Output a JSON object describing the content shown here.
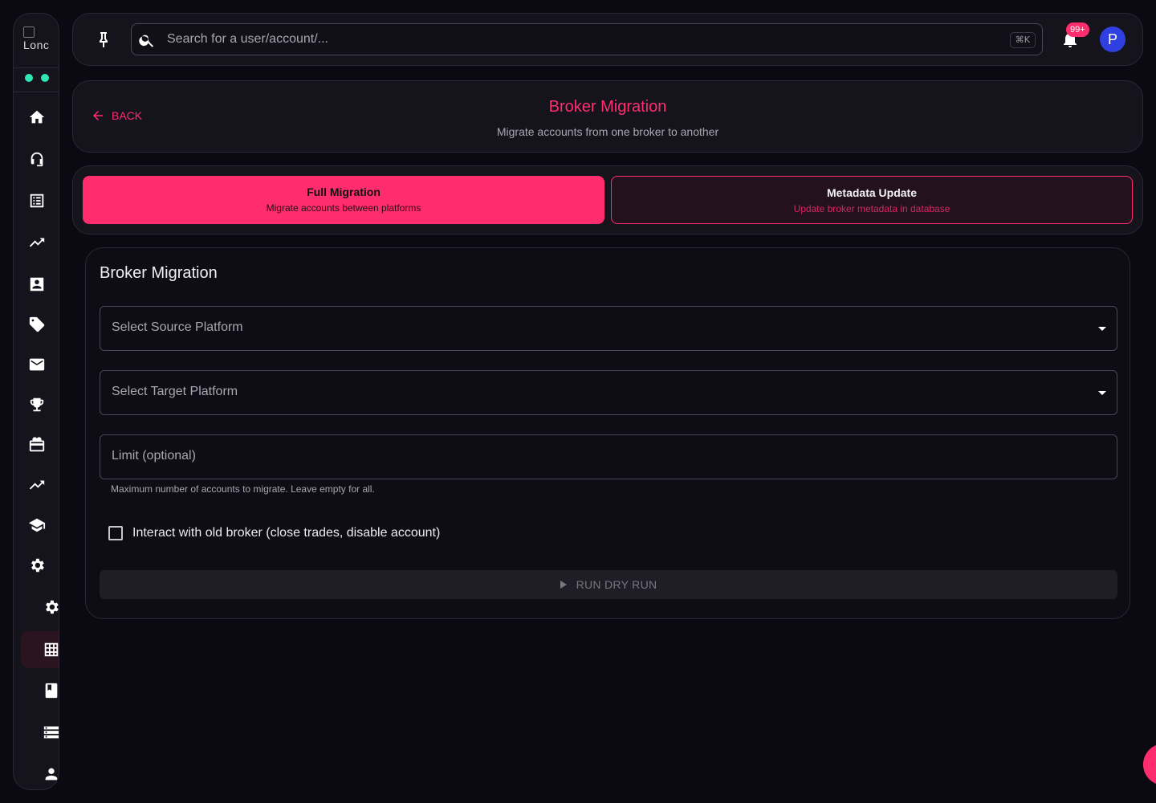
{
  "sidebar": {
    "logo_alt": "Logo",
    "logo_text": "Lonc",
    "items": [
      {
        "name": "home-icon"
      },
      {
        "name": "support-icon"
      },
      {
        "name": "list-icon"
      },
      {
        "name": "trending-icon"
      },
      {
        "name": "contact-icon"
      },
      {
        "name": "tag-icon"
      },
      {
        "name": "mail-icon"
      },
      {
        "name": "trophy-icon"
      },
      {
        "name": "gift-icon"
      },
      {
        "name": "trending-icon"
      },
      {
        "name": "school-icon"
      },
      {
        "name": "gear-icon"
      },
      {
        "name": "gear-icon"
      },
      {
        "name": "grid-icon"
      },
      {
        "name": "book-icon"
      },
      {
        "name": "storage-icon"
      },
      {
        "name": "person-icon"
      }
    ],
    "status_color": "#2ee6b6"
  },
  "topbar": {
    "search_placeholder": "Search for a user/account/...",
    "shortcut": "⌘K",
    "notifications_badge": "99+",
    "avatar_letter": "P"
  },
  "header": {
    "back_label": "BACK",
    "title": "Broker Migration",
    "subtitle": "Migrate accounts from one broker to another"
  },
  "tabs": [
    {
      "title": "Full Migration",
      "subtitle": "Migrate accounts between platforms",
      "active": true
    },
    {
      "title": "Metadata Update",
      "subtitle": "Update broker metadata in database",
      "active": false
    }
  ],
  "form": {
    "title": "Broker Migration",
    "source_placeholder": "Select Source Platform",
    "target_placeholder": "Select Target Platform",
    "limit_placeholder": "Limit (optional)",
    "limit_helper": "Maximum number of accounts to migrate. Leave empty for all.",
    "checkbox_label": "Interact with old broker (close trades, disable account)",
    "run_button": "RUN DRY RUN"
  },
  "colors": {
    "accent": "#ff2d6e",
    "background": "#0b0a12",
    "surface": "#15141d",
    "avatar": "#2f3fe0"
  }
}
